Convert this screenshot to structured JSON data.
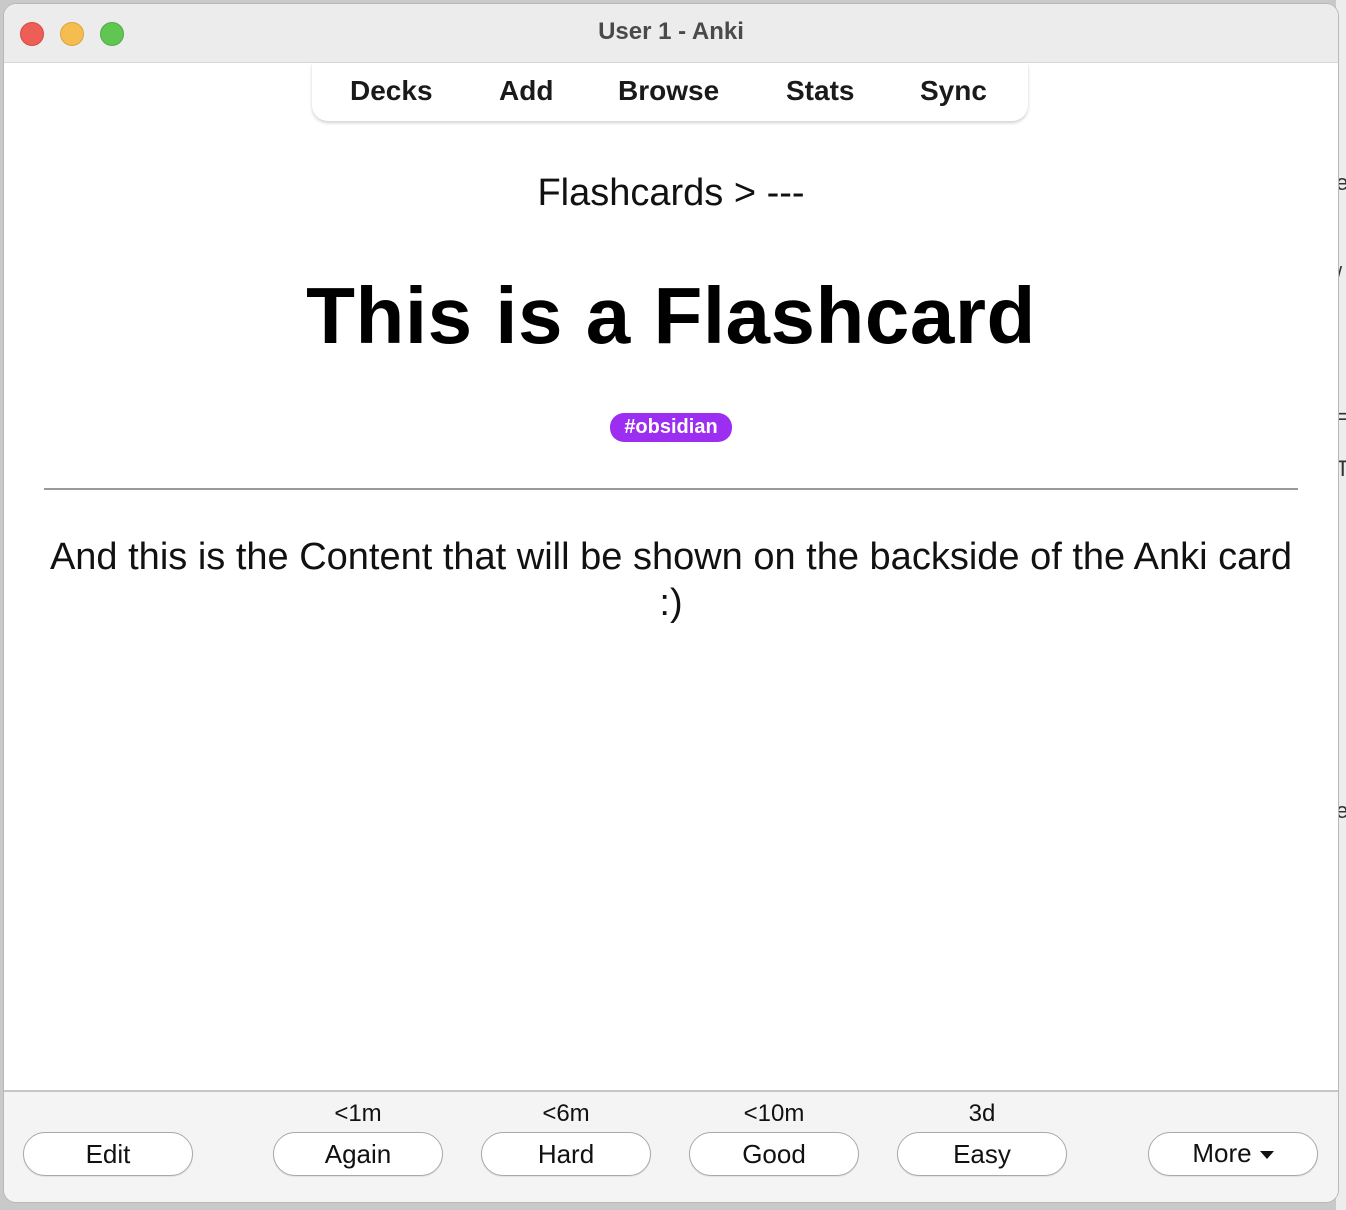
{
  "window": {
    "title": "User 1 - Anki"
  },
  "toolbar": {
    "items": [
      {
        "label": "Decks"
      },
      {
        "label": "Add"
      },
      {
        "label": "Browse"
      },
      {
        "label": "Stats"
      },
      {
        "label": "Sync"
      }
    ]
  },
  "card": {
    "deck_path": "Flashcards > ---",
    "front": "This is a Flashcard",
    "tag": "#obsidian",
    "back": "And this is the Content that will be shown on the backside of the Anki card :)"
  },
  "review_bar": {
    "edit_label": "Edit",
    "answers": [
      {
        "interval": "<1m",
        "label": "Again"
      },
      {
        "interval": "<6m",
        "label": "Hard"
      },
      {
        "interval": "<10m",
        "label": "Good"
      },
      {
        "interval": "3d",
        "label": "Easy"
      }
    ],
    "more_label": "More"
  },
  "background_window": {
    "fragments": [
      "e",
      "/",
      "=",
      "T",
      "e"
    ]
  },
  "colors": {
    "tag_background": "#9b2ef0",
    "traffic_close": "#ee5e57",
    "traffic_minimize": "#f5bd4f",
    "traffic_maximize": "#61c554"
  }
}
